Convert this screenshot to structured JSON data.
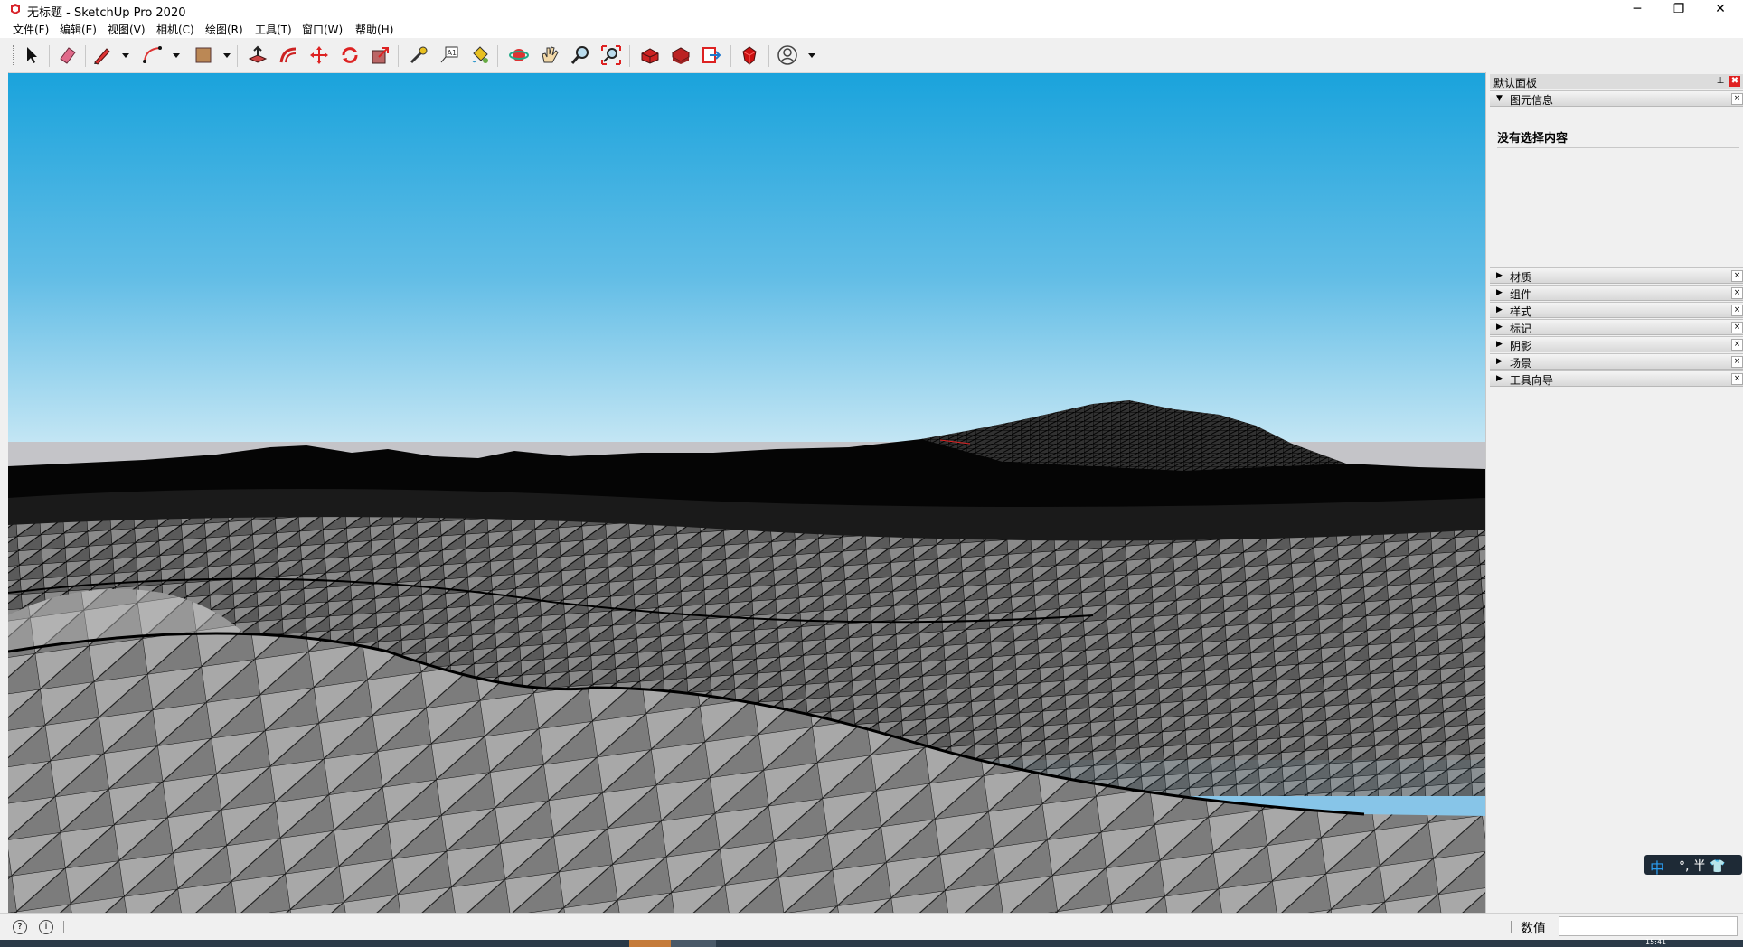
{
  "window": {
    "title": "无标题 - SketchUp Pro 2020",
    "controls": {
      "minimize": "─",
      "maximize": "❐",
      "close": "✕"
    }
  },
  "menu": {
    "items": [
      "文件(F)",
      "编辑(E)",
      "视图(V)",
      "相机(C)",
      "绘图(R)",
      "工具(T)",
      "窗口(W)",
      "帮助(H)"
    ]
  },
  "toolbar": {
    "tools": [
      "select-icon",
      "eraser-icon",
      "line-pencil-icon",
      "arc-icon",
      "rectangle-icon",
      "push-pull-icon",
      "offset-icon",
      "move-icon",
      "rotate-icon",
      "scale-icon",
      "tape-measure-icon",
      "text-icon",
      "paint-bucket-icon",
      "orbit-icon",
      "pan-icon",
      "zoom-icon",
      "zoom-extents-icon",
      "3d-warehouse-icon",
      "extension-warehouse-icon",
      "send-to-layout-icon",
      "extension-manager-icon",
      "account-icon"
    ]
  },
  "tray": {
    "title": "默认面板",
    "pin": "✖",
    "entity_info": {
      "label": "图元信息",
      "status": "没有选择内容"
    },
    "panels": [
      {
        "label": "材质"
      },
      {
        "label": "组件"
      },
      {
        "label": "样式"
      },
      {
        "label": "标记"
      },
      {
        "label": "阴影"
      },
      {
        "label": "场景"
      },
      {
        "label": "工具向导"
      }
    ],
    "expanded_arrow": "▼",
    "collapsed_arrow": "▶",
    "close_glyph": "×"
  },
  "ime": {
    "mode": "中",
    "rest": "°, 半 👕"
  },
  "status": {
    "icon1": "?",
    "icon2": "i",
    "measure_label": "数值",
    "measure_value": ""
  },
  "taskbar": {
    "clock": "15:41"
  },
  "colors": {
    "sky_top": "#1aa3dc",
    "sky_horizon": "#c4e6f4",
    "ground_haze": "#c4c4c8",
    "terrain_light": "#b8b8b8",
    "terrain_dark": "#6e6e6e",
    "wire": "#000000",
    "accent_red": "#e02020"
  }
}
